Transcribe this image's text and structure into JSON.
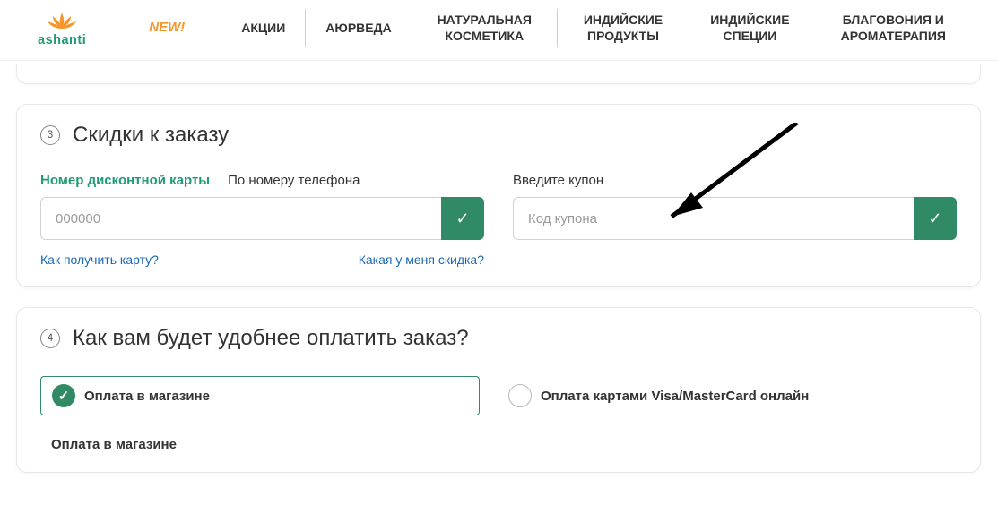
{
  "logo": {
    "text": "ashanti"
  },
  "nav": {
    "items": [
      "NEW!",
      "АКЦИИ",
      "АЮРВЕДА",
      "НАТУРАЛЬНАЯ КОСМЕТИКА",
      "ИНДИЙСКИЕ ПРОДУКТЫ",
      "ИНДИЙСКИЕ СПЕЦИИ",
      "БЛАГОВОНИЯ И АРОМАТЕРАПИЯ"
    ]
  },
  "step3": {
    "number": "3",
    "title": "Скидки к заказу",
    "discount": {
      "label_primary": "Номер дисконтной карты",
      "label_secondary": "По номеру телефона",
      "placeholder": "000000",
      "help_get_card": "Как получить карту?",
      "help_what_discount": "Какая у меня скидка?"
    },
    "coupon": {
      "label": "Введите купон",
      "placeholder": "Код купона"
    }
  },
  "step4": {
    "number": "4",
    "title": "Как вам будет удобнее оплатить заказ?",
    "options": [
      "Оплата в магазине",
      "Оплата картами Visa/MasterCard онлайн"
    ],
    "selected_label": "Оплата в магазине"
  }
}
